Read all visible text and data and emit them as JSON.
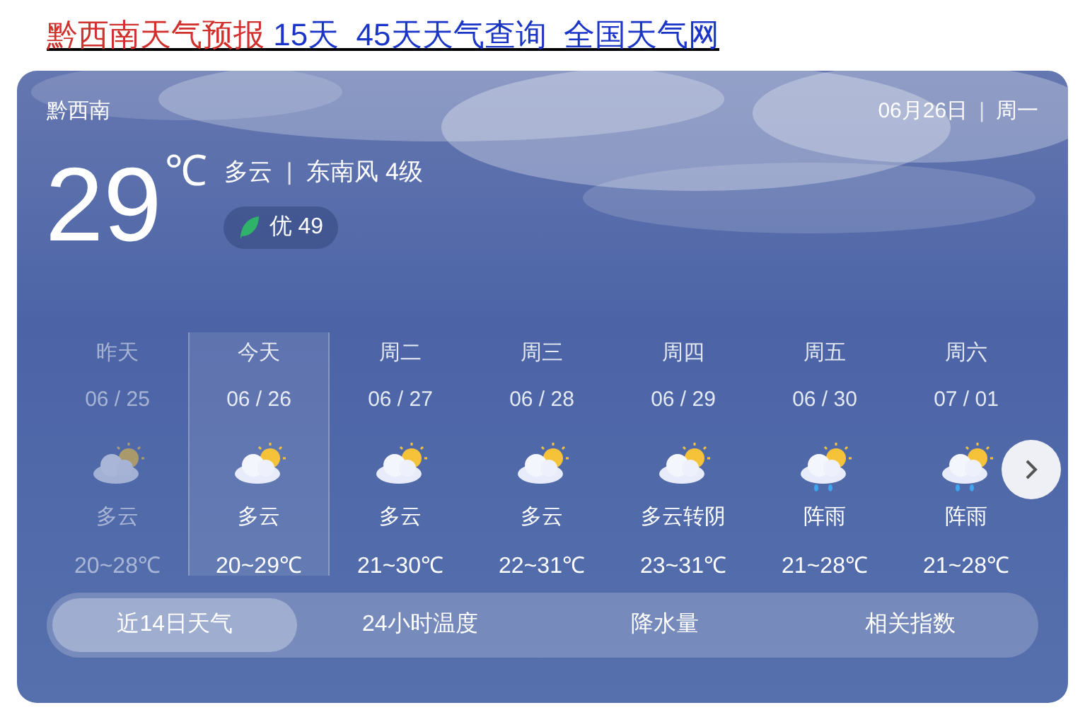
{
  "headline": {
    "parts": [
      {
        "text": "黔西南天气预报",
        "color": "#d0312d"
      },
      {
        "text": " 15天  45天天气查询  全国天气网",
        "color": "#1a35c8"
      }
    ]
  },
  "card": {
    "location": "黔西南",
    "date": "06月26日",
    "date_separator": "|",
    "weekday": "周一",
    "temperature": "29",
    "unit": "℃",
    "condition": "多云",
    "wind_separator": "|",
    "wind": "东南风 4级",
    "aqi": "优 49"
  },
  "days": [
    {
      "day": "昨天",
      "date": "06 / 25",
      "kind": "cloudy",
      "condition": "多云",
      "range": "20~28℃",
      "past": true,
      "selected": false
    },
    {
      "day": "今天",
      "date": "06 / 26",
      "kind": "cloudy",
      "condition": "多云",
      "range": "20~29℃",
      "past": false,
      "selected": true
    },
    {
      "day": "周二",
      "date": "06 / 27",
      "kind": "cloudy",
      "condition": "多云",
      "range": "21~30℃",
      "past": false,
      "selected": false
    },
    {
      "day": "周三",
      "date": "06 / 28",
      "kind": "cloudy",
      "condition": "多云",
      "range": "22~31℃",
      "past": false,
      "selected": false
    },
    {
      "day": "周四",
      "date": "06 / 29",
      "kind": "cloudy",
      "condition": "多云转阴",
      "range": "23~31℃",
      "past": false,
      "selected": false
    },
    {
      "day": "周五",
      "date": "06 / 30",
      "kind": "shower",
      "condition": "阵雨",
      "range": "21~28℃",
      "past": false,
      "selected": false
    },
    {
      "day": "周六",
      "date": "07 / 01",
      "kind": "shower",
      "condition": "阵雨",
      "range": "21~28℃",
      "past": false,
      "selected": false
    }
  ],
  "tabs": [
    {
      "label": "近14日天气",
      "selected": true
    },
    {
      "label": "24小时温度",
      "selected": false
    },
    {
      "label": "降水量",
      "selected": false
    },
    {
      "label": "相关指数",
      "selected": false
    }
  ]
}
